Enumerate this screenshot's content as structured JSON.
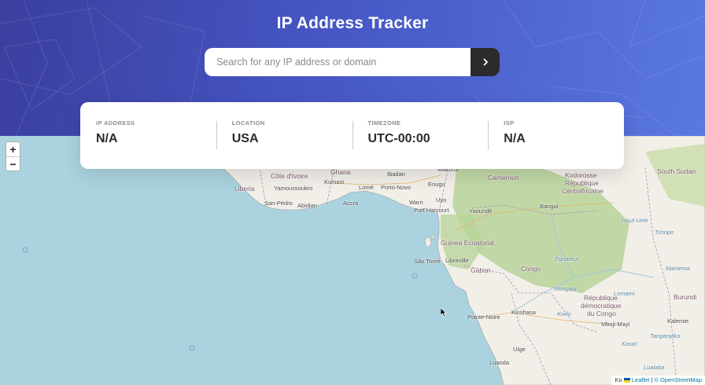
{
  "header": {
    "title": "IP Address Tracker",
    "search_placeholder": "Search for any IP address or domain",
    "search_value": "",
    "submit_icon": "chevron-right-icon"
  },
  "info": [
    {
      "label": "IP ADDRESS",
      "value": "N/A"
    },
    {
      "label": "LOCATION",
      "value": "USA"
    },
    {
      "label": "TIMEZONE",
      "value": "UTC-00:00"
    },
    {
      "label": "ISP",
      "value": "N/A"
    }
  ],
  "map": {
    "zoom_in": "+",
    "zoom_out": "−",
    "labels": {
      "ghana": "Ghana",
      "makurdi": "Makurdi",
      "kodorosse": "Kodorosse",
      "southsudan": "South Sudan",
      "liberia": "Liberia",
      "cotedivoire": "Côte d'Ivoire",
      "kumasi": "Kumasi",
      "ibadan": "Ibadan",
      "cameroun": "Cameroun",
      "republique": "République",
      "centrafricaine": "Centrafricaine",
      "yamoussoukro": "Yamoussoukro",
      "lome": "Lomé",
      "portonovo": "Porto-Novo",
      "enugu": "Enugu",
      "sanpedro": "San-Pédro",
      "abidjan": "Abidjan",
      "accra": "Accra",
      "warri": "Warri",
      "uyo": "Uyo",
      "portharcourt": "Port Harcourt",
      "yaounde": "Yaoundé",
      "bangui": "Bangui",
      "guinea": "Guinea Ecuatorial",
      "libreville": "Libreville",
      "saotome": "São Tomé",
      "gabon": "Gabon",
      "congo": "Congo",
      "pointenoire": "Pointe-Noire",
      "kinshasa": "Kinshasa",
      "rdc1": "République",
      "rdc2": "démocratique",
      "rdc3": "du Congo",
      "mbujimayi": "Mbuji-Mayi",
      "kalemie": "Kalemie",
      "burundi": "Burundi",
      "luanda": "Luanda",
      "uige": "Uíge",
      "equateur": "Équateur",
      "kasai": "Kasaï",
      "kwilu": "Kwilu",
      "lomami": "Lomami",
      "tanganyika": "Tanganyika",
      "mongala": "Mongala",
      "hautuele": "Haut-Uele",
      "tshopo": "Tshopo",
      "maniema": "Maniema",
      "lualaba": "Lualaba"
    },
    "attribution": {
      "ko": "Ko",
      "leaflet": "Leaflet",
      "sep": "|",
      "osm": "© OpenStreetMap"
    }
  },
  "colors": {
    "accent_dark": "#2b2b2b",
    "header_gradient_start": "#3b3f9e",
    "header_gradient_end": "#5a78e0",
    "ocean": "#aad3df",
    "land": "#f2efe9",
    "forest": "#b8d49a"
  }
}
